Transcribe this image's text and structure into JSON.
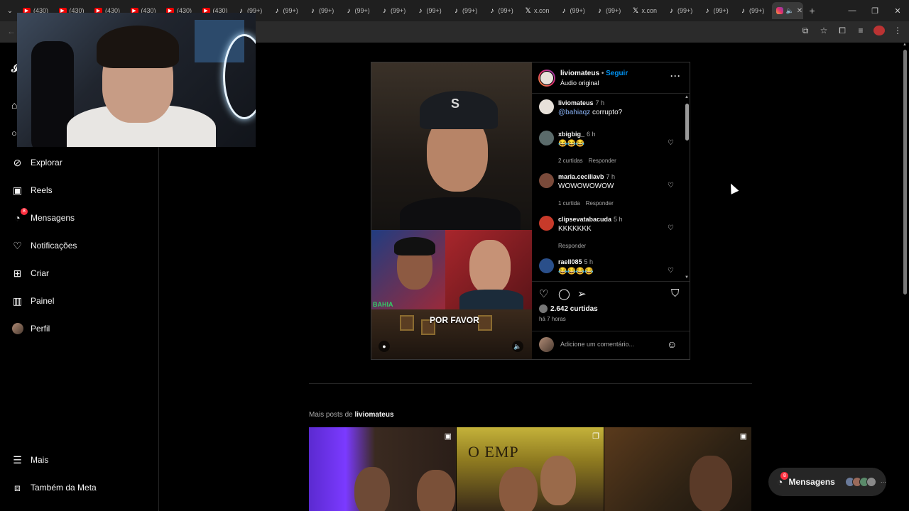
{
  "browser": {
    "tabs": [
      {
        "icon": "youtube-icon",
        "label": "(430)"
      },
      {
        "icon": "youtube-icon",
        "label": "(430)"
      },
      {
        "icon": "youtube-icon",
        "label": "(430)"
      },
      {
        "icon": "youtube-icon",
        "label": "(430)"
      },
      {
        "icon": "youtube-icon",
        "label": "(430)"
      },
      {
        "icon": "youtube-icon",
        "label": "(430)"
      },
      {
        "icon": "tiktok-icon",
        "label": "(99+)"
      },
      {
        "icon": "tiktok-icon",
        "label": "(99+)"
      },
      {
        "icon": "tiktok-icon",
        "label": "(99+)"
      },
      {
        "icon": "tiktok-icon",
        "label": "(99+)"
      },
      {
        "icon": "tiktok-icon",
        "label": "(99+)"
      },
      {
        "icon": "tiktok-icon",
        "label": "(99+)"
      },
      {
        "icon": "tiktok-icon",
        "label": "(99+)"
      },
      {
        "icon": "tiktok-icon",
        "label": "(99+)"
      },
      {
        "icon": "x-icon",
        "label": "x.con"
      },
      {
        "icon": "tiktok-icon",
        "label": "(99+)"
      },
      {
        "icon": "tiktok-icon",
        "label": "(99+)"
      },
      {
        "icon": "x-icon",
        "label": "x.con"
      },
      {
        "icon": "tiktok-icon",
        "label": "(99+)"
      },
      {
        "icon": "tiktok-icon",
        "label": "(99+)"
      },
      {
        "icon": "tiktok-icon",
        "label": "(99+)"
      }
    ]
  },
  "nav": {
    "explore": "Explorar",
    "reels": "Reels",
    "messages": "Mensagens",
    "messages_badge": "8",
    "notifications": "Notificações",
    "create": "Criar",
    "dashboard": "Painel",
    "profile": "Perfil",
    "more": "Mais",
    "meta": "Também da Meta"
  },
  "post": {
    "username": "liviomateus",
    "separator": "•",
    "follow": "Seguir",
    "audio": "Áudio original",
    "media_caption": "POR FAVOR",
    "media_tag": "BAHIA",
    "comments": [
      {
        "user": "liviomateus",
        "time": "7 h",
        "mention": "@bahiaqz",
        "text": " corrupto?",
        "likes": "",
        "reply": "",
        "avatar": "#e7e1da"
      },
      {
        "user": "xbigbig_",
        "time": "6 h",
        "mention": "",
        "text": "😂😂😂",
        "likes": "2 curtidas",
        "reply": "Responder",
        "avatar": "#5b6b6b"
      },
      {
        "user": "maria.ceciliavb",
        "time": "7 h",
        "mention": "",
        "text": "WOWOWOWOW",
        "likes": "1 curtida",
        "reply": "Responder",
        "avatar": "#7a4a3a"
      },
      {
        "user": "clipsevatabacuda",
        "time": "5 h",
        "mention": "",
        "text": "KKKKKKK",
        "likes": "",
        "reply": "Responder",
        "avatar": "#c73a2a"
      },
      {
        "user": "raell085",
        "time": "5 h",
        "mention": "",
        "text": "😂😂😂😂",
        "likes": "",
        "reply": "",
        "avatar": "#2a4f8a"
      }
    ],
    "likes_count": "2.642 curtidas",
    "posted_ago": "há 7 horas",
    "comment_placeholder": "Adicione um comentário..."
  },
  "more_posts": {
    "prefix": "Mais posts de",
    "username": "liviomateus",
    "thumb2_text": "O EMP"
  },
  "messages_pill": {
    "label": "Mensagens",
    "badge": "8"
  }
}
